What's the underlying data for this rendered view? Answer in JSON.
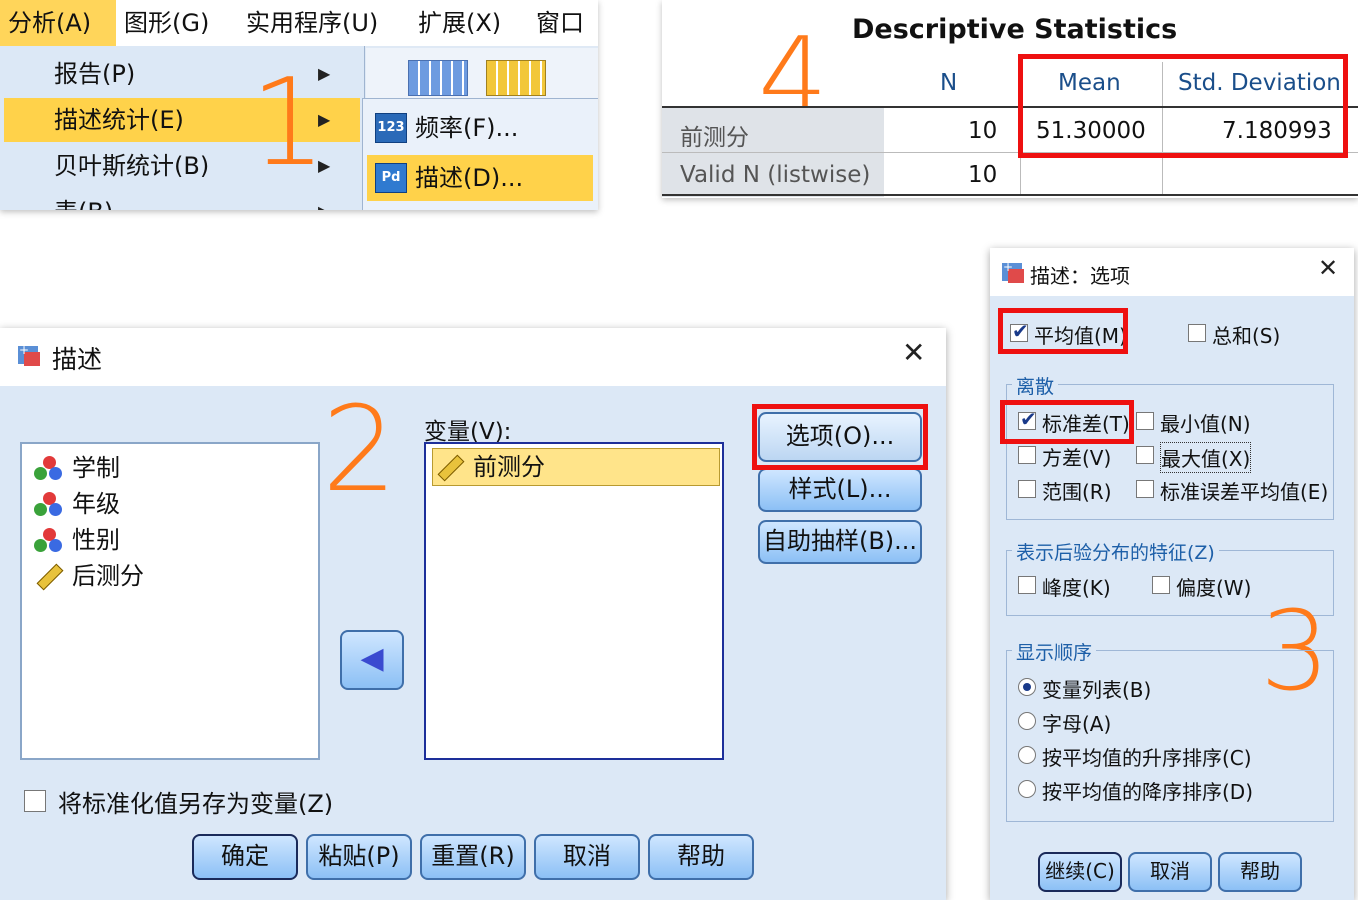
{
  "colors": {
    "highlight": "#ffd24a",
    "red_box": "#ee1010",
    "step_number": "#ff7a1a",
    "dialog_bg": "#dce8f6"
  },
  "step_numbers": {
    "one": "1",
    "two": "2",
    "three": "3",
    "four": "4"
  },
  "menu": {
    "bar": [
      "分析(A)",
      "图形(G)",
      "实用程序(U)",
      "扩展(X)",
      "窗口("
    ],
    "dropdown": [
      "报告(P)",
      "描述统计(E)",
      "贝叶斯统计(B)",
      "表(B)"
    ],
    "submenu": [
      {
        "icon": "123",
        "label": "频率(F)..."
      },
      {
        "icon": "Pd",
        "label": "描述(D)..."
      }
    ]
  },
  "stats": {
    "title": "Descriptive Statistics",
    "columns": [
      "N",
      "Mean",
      "Std. Deviation"
    ],
    "rows": [
      {
        "name": "前测分",
        "n": "10",
        "mean": "51.30000",
        "sd": "7.180993"
      },
      {
        "name": "Valid N (listwise)",
        "n": "10",
        "mean": "",
        "sd": ""
      }
    ]
  },
  "describe_dialog": {
    "title": "描述",
    "source_vars": [
      "学制",
      "年级",
      "性别",
      "后测分"
    ],
    "target_label": "变量(V):",
    "target_vars": [
      "前测分"
    ],
    "side_buttons": [
      "选项(O)...",
      "样式(L)...",
      "自助抽样(B)..."
    ],
    "save_z_label": "将标准化值另存为变量(Z)",
    "save_z_checked": false,
    "bottom_buttons": [
      "确定",
      "粘贴(P)",
      "重置(R)",
      "取消",
      "帮助"
    ]
  },
  "options_dialog": {
    "title": "描述：选项",
    "mean": {
      "label": "平均值(M)",
      "checked": true
    },
    "sum": {
      "label": "总和(S)",
      "checked": false
    },
    "dispersion": {
      "label": "离散",
      "items": [
        {
          "label": "标准差(T)",
          "checked": true
        },
        {
          "label": "最小值(N)",
          "checked": false
        },
        {
          "label": "方差(V)",
          "checked": false
        },
        {
          "label": "最大值(X)",
          "checked": false
        },
        {
          "label": "范围(R)",
          "checked": false
        },
        {
          "label": "标准误差平均值(E)",
          "checked": false
        }
      ]
    },
    "distribution": {
      "label": "表示后验分布的特征(Z)",
      "items": [
        {
          "label": "峰度(K)",
          "checked": false
        },
        {
          "label": "偏度(W)",
          "checked": false
        }
      ]
    },
    "display_order": {
      "label": "显示顺序",
      "items": [
        "变量列表(B)",
        "字母(A)",
        "按平均值的升序排序(C)",
        "按平均值的降序排序(D)"
      ],
      "selected": 0
    },
    "buttons": [
      "继续(C)",
      "取消",
      "帮助"
    ]
  }
}
